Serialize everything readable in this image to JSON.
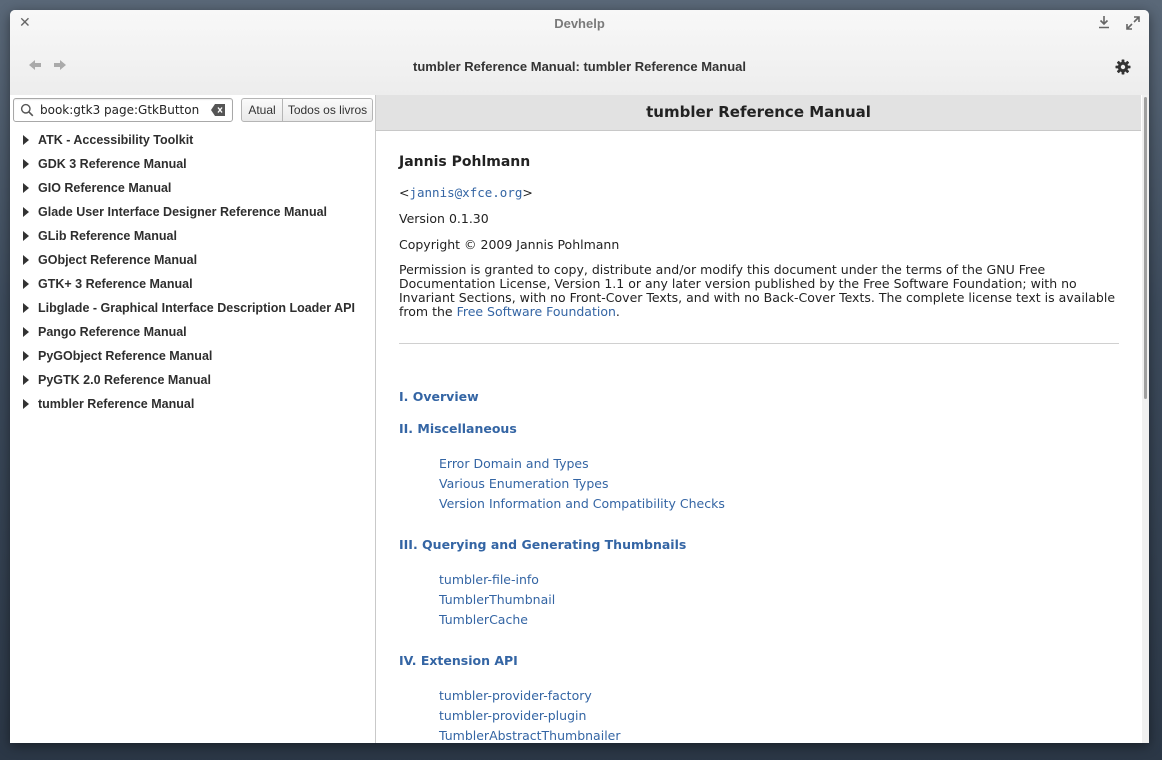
{
  "window": {
    "title": "Devhelp",
    "header_title": "tumbler Reference Manual: tumbler Reference Manual"
  },
  "search": {
    "value": "book:gtk3 page:GtkButton",
    "placeholder": ""
  },
  "scope": {
    "current_label": "Atual",
    "all_label": "Todos os livros"
  },
  "books": [
    "ATK - Accessibility Toolkit",
    "GDK 3 Reference Manual",
    "GIO Reference Manual",
    "Glade User Interface Designer Reference Manual",
    "GLib Reference Manual",
    "GObject Reference Manual",
    "GTK+ 3 Reference Manual",
    "Libglade - Graphical Interface Description Loader API",
    "Pango Reference Manual",
    "PyGObject Reference Manual",
    "PyGTK 2.0 Reference Manual",
    "tumbler Reference Manual"
  ],
  "doc": {
    "heading": "tumbler Reference Manual",
    "author": "Jannis Pohlmann",
    "email_open": "<",
    "email": "jannis@xfce.org",
    "email_close": ">",
    "version": "Version 0.1.30",
    "copyright": "Copyright © 2009 Jannis Pohlmann",
    "permission_text": "Permission is granted to copy, distribute and/or modify this document under the terms of the GNU Free Documentation License, Version 1.1 or any later version published by the Free Software Foundation; with no Invariant Sections, with no Front-Cover Texts, and with no Back-Cover Texts. The complete license text is available from the ",
    "permission_link": "Free Software Foundation",
    "permission_end": ".",
    "parts": [
      {
        "title": "I. Overview",
        "items": []
      },
      {
        "title": "II. Miscellaneous",
        "items": [
          "Error Domain and Types",
          "Various Enumeration Types",
          "Version Information and Compatibility Checks"
        ]
      },
      {
        "title": "III. Querying and Generating Thumbnails",
        "items": [
          "tumbler-file-info",
          "TumblerThumbnail",
          "TumblerCache"
        ]
      },
      {
        "title": "IV. Extension API",
        "items": [
          "tumbler-provider-factory",
          "tumbler-provider-plugin",
          "TumblerAbstractThumbnailer"
        ]
      }
    ]
  },
  "icons": {
    "close": "close-icon",
    "download": "download-icon",
    "maximize": "maximize-icon",
    "back": "go-back-icon",
    "forward": "go-forward-icon",
    "settings": "gear-icon",
    "search": "search-icon",
    "clear": "clear-icon"
  }
}
